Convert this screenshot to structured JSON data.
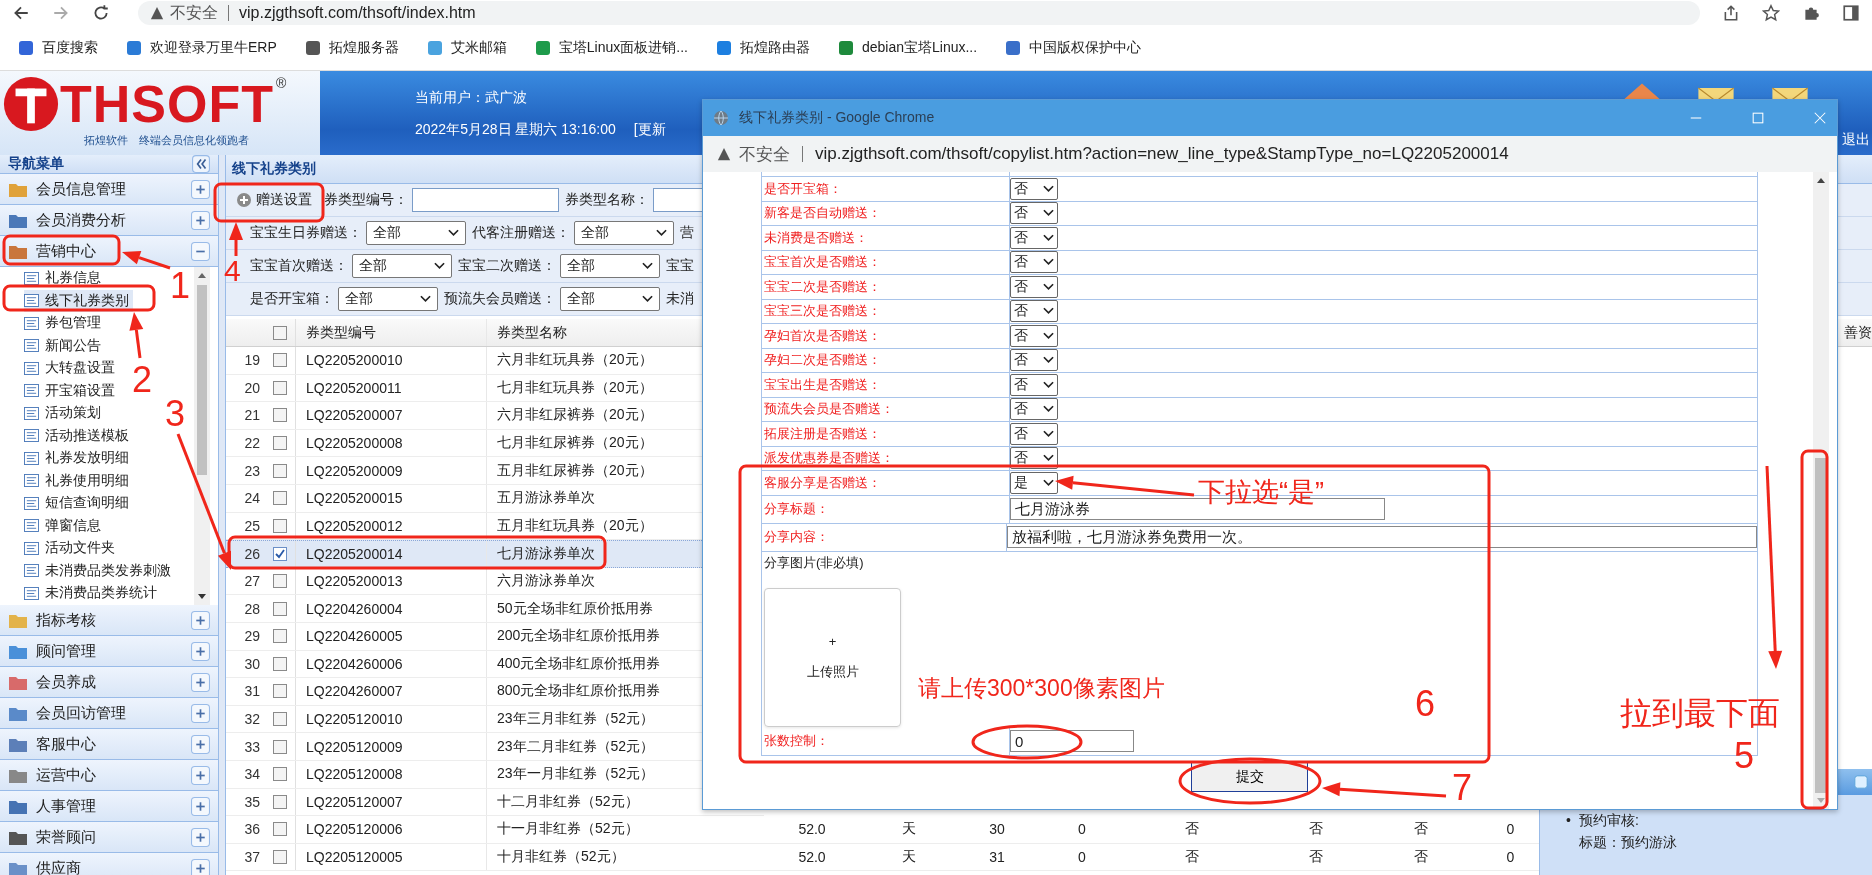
{
  "browser": {
    "warning": "不安全",
    "address": "vip.zjgthsoft.com/thsoft/index.htm"
  },
  "bookmarks": [
    "百度搜索",
    "欢迎登录万里牛ERP",
    "拓煌服务器",
    "艾米邮箱",
    "宝塔Linux面板进销...",
    "拓煌路由器",
    "debian宝塔Linux...",
    "中国版权保护中心"
  ],
  "header": {
    "logo": "THSOFT",
    "logo_mark": "®",
    "tagline": "拓煌软件　终端会员信息化领跑者",
    "user": "当前用户：武广波",
    "datetime": "2022年5月28日 星期六 13:16:00",
    "update_link": "[更新",
    "logout": "退出"
  },
  "sidebar": {
    "title": "导航菜单",
    "sections": [
      {
        "label": "会员信息管理",
        "expanded": false
      },
      {
        "label": "会员消费分析",
        "expanded": false
      },
      {
        "label": "营销中心",
        "expanded": true,
        "children": [
          {
            "label": "礼券信息",
            "selected": false
          },
          {
            "label": "线下礼券类别",
            "selected": true
          },
          {
            "label": "券包管理",
            "selected": false
          },
          {
            "label": "新闻公告",
            "selected": false
          },
          {
            "label": "大转盘设置",
            "selected": false
          },
          {
            "label": "开宝箱设置",
            "selected": false
          },
          {
            "label": "活动策划",
            "selected": false
          },
          {
            "label": "活动推送模板",
            "selected": false
          },
          {
            "label": "礼券发放明细",
            "selected": false
          },
          {
            "label": "礼券使用明细",
            "selected": false
          },
          {
            "label": "短信查询明细",
            "selected": false
          },
          {
            "label": "弹窗信息",
            "selected": false
          },
          {
            "label": "活动文件夹",
            "selected": false
          },
          {
            "label": "未消费品类发券刺激",
            "selected": false
          },
          {
            "label": "未消费品类券统计",
            "selected": false
          }
        ]
      },
      {
        "label": "指标考核",
        "expanded": false
      },
      {
        "label": "顾问管理",
        "expanded": false
      },
      {
        "label": "会员养成",
        "expanded": false
      },
      {
        "label": "会员回访管理",
        "expanded": false
      },
      {
        "label": "客服中心",
        "expanded": false
      },
      {
        "label": "运营中心",
        "expanded": false
      },
      {
        "label": "人事管理",
        "expanded": false
      },
      {
        "label": "荣誉顾问",
        "expanded": false
      },
      {
        "label": "供应商",
        "expanded": false
      }
    ]
  },
  "panel": {
    "title": "线下礼券类别",
    "toolbar_button": "赠送设置",
    "filter_rows": [
      [
        {
          "kind": "input",
          "label": "券类型编号："
        },
        {
          "kind": "input",
          "label": "券类型名称："
        }
      ],
      [
        {
          "kind": "select",
          "label": "宝宝生日券赠送：",
          "value": "全部"
        },
        {
          "kind": "select",
          "label": "代客注册赠送：",
          "value": "全部"
        },
        {
          "kind": "label",
          "label": "营"
        }
      ],
      [
        {
          "kind": "select",
          "label": "宝宝首次赠送：",
          "value": "全部"
        },
        {
          "kind": "select",
          "label": "宝宝二次赠送：",
          "value": "全部"
        },
        {
          "kind": "label",
          "label": "宝宝"
        }
      ],
      [
        {
          "kind": "select",
          "label": "是否开宝箱：",
          "value": "全部"
        },
        {
          "kind": "select",
          "label": "预流失会员赠送：",
          "value": "全部"
        },
        {
          "kind": "label",
          "label": "未消"
        }
      ]
    ]
  },
  "table": {
    "columns": [
      "券类型编号",
      "券类型名称"
    ],
    "last_column": "善资",
    "header_checked": false,
    "rows": [
      {
        "no": "19",
        "code": "LQ2205200010",
        "name": "六月非红玩具券（20元）",
        "selected": false,
        "checked": false
      },
      {
        "no": "20",
        "code": "LQ2205200011",
        "name": "七月非红玩具券（20元）",
        "selected": false,
        "checked": false
      },
      {
        "no": "21",
        "code": "LQ2205200007",
        "name": "六月非红尿裤券（20元）",
        "selected": false,
        "checked": false
      },
      {
        "no": "22",
        "code": "LQ2205200008",
        "name": "七月非红尿裤券（20元）",
        "selected": false,
        "checked": false
      },
      {
        "no": "23",
        "code": "LQ2205200009",
        "name": "五月非红尿裤券（20元）",
        "selected": false,
        "checked": false
      },
      {
        "no": "24",
        "code": "LQ2205200015",
        "name": "五月游泳券单次",
        "selected": false,
        "checked": false
      },
      {
        "no": "25",
        "code": "LQ2205200012",
        "name": "五月非红玩具券（20元）",
        "selected": false,
        "checked": false
      },
      {
        "no": "26",
        "code": "LQ2205200014",
        "name": "七月游泳券单次",
        "selected": true,
        "checked": true
      },
      {
        "no": "27",
        "code": "LQ2205200013",
        "name": "六月游泳券单次",
        "selected": false,
        "checked": false
      },
      {
        "no": "28",
        "code": "LQ2204260004",
        "name": "50元全场非红原价抵用券",
        "selected": false,
        "checked": false
      },
      {
        "no": "29",
        "code": "LQ2204260005",
        "name": "200元全场非红原价抵用券",
        "selected": false,
        "checked": false
      },
      {
        "no": "30",
        "code": "LQ2204260006",
        "name": "400元全场非红原价抵用券",
        "selected": false,
        "checked": false
      },
      {
        "no": "31",
        "code": "LQ2204260007",
        "name": "800元全场非红原价抵用券",
        "selected": false,
        "checked": false
      },
      {
        "no": "32",
        "code": "LQ2205120010",
        "name": "23年三月非红券（52元）",
        "selected": false,
        "checked": false
      },
      {
        "no": "33",
        "code": "LQ2205120009",
        "name": "23年二月非红券（52元）",
        "selected": false,
        "checked": false
      },
      {
        "no": "34",
        "code": "LQ2205120008",
        "name": "23年一月非红券（52元）",
        "selected": false,
        "checked": false
      },
      {
        "no": "35",
        "code": "LQ2205120007",
        "name": "十二月非红券（52元）",
        "selected": false,
        "checked": false
      },
      {
        "no": "36",
        "code": "LQ2205120006",
        "name": "十一月非红券（52元）",
        "selected": false,
        "checked": false,
        "extra": [
          "52.0",
          "天",
          "30",
          "0",
          "否",
          "否",
          "否",
          "0"
        ]
      },
      {
        "no": "37",
        "code": "LQ2205120005",
        "name": "十月非红券（52元）",
        "selected": false,
        "checked": false,
        "extra": [
          "52.0",
          "天",
          "31",
          "0",
          "否",
          "否",
          "否",
          "0"
        ]
      }
    ]
  },
  "notice": {
    "items": [
      {
        "bullet": "•",
        "label": "预约审核:",
        "detail": "标题：预约游泳"
      }
    ]
  },
  "popup": {
    "title": "线下礼券类别 - Google Chrome",
    "warning": "不安全",
    "address": "vip.zjgthsoft.com/thsoft/copylist.htm?action=new_line_type&StampType_no=LQ2205200014",
    "rows": [
      {
        "kind": "select",
        "label": "是否开宝箱：",
        "value": "否"
      },
      {
        "kind": "select",
        "label": "新客是否自动赠送：",
        "value": "否"
      },
      {
        "kind": "select",
        "label": "未消费是否赠送：",
        "value": "否"
      },
      {
        "kind": "select",
        "label": "宝宝首次是否赠送：",
        "value": "否"
      },
      {
        "kind": "select",
        "label": "宝宝二次是否赠送：",
        "value": "否"
      },
      {
        "kind": "select",
        "label": "宝宝三次是否赠送：",
        "value": "否"
      },
      {
        "kind": "select",
        "label": "孕妇首次是否赠送：",
        "value": "否"
      },
      {
        "kind": "select",
        "label": "孕妇二次是否赠送：",
        "value": "否"
      },
      {
        "kind": "select",
        "label": "宝宝出生是否赠送：",
        "value": "否"
      },
      {
        "kind": "select",
        "label": "预流失会员是否赠送：",
        "value": "否"
      },
      {
        "kind": "select",
        "label": "拓展注册是否赠送：",
        "value": "否"
      },
      {
        "kind": "select",
        "label": "派发优惠券是否赠送：",
        "value": "否"
      },
      {
        "kind": "select",
        "label": "客服分享是否赠送：",
        "value": "是"
      },
      {
        "kind": "short_text",
        "label": "分享标题：",
        "value": "七月游泳券"
      },
      {
        "kind": "long_text",
        "label": "分享内容：",
        "value": "放福利啦，七月游泳券免费用一次。"
      },
      {
        "kind": "upload",
        "label": "分享图片(非必填)",
        "plus": "+",
        "button": "上传照片"
      },
      {
        "kind": "number",
        "label": "张数控制：",
        "value": "0"
      }
    ],
    "submit": "提交"
  },
  "annotations": {
    "numbers": [
      "1",
      "2",
      "3",
      "4",
      "5",
      "6",
      "7"
    ],
    "notes": [
      "下拉选“是”",
      "请上传300*300像素图片",
      "拉到最下面"
    ]
  }
}
